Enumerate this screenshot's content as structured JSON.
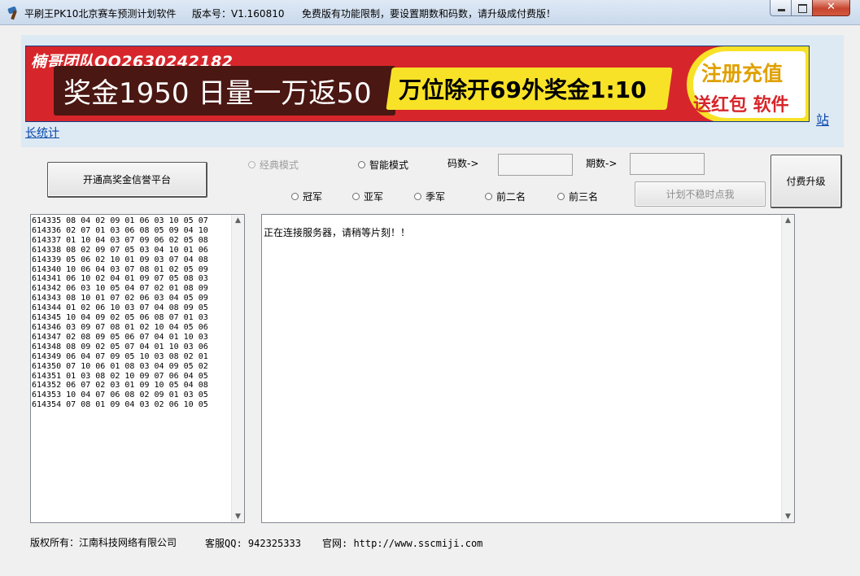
{
  "titlebar": {
    "app_name": "平刷王PK10北京赛车预测计划软件",
    "version": "版本号：V1.160810",
    "notice": "免费版有功能限制，要设置期数和码数，请升级成付费版！",
    "minimize": "—",
    "maximize": "□",
    "close": "✕"
  },
  "banner": {
    "team": "楠哥团队QQ2630242182",
    "main": "奖金1950 日量一万返50",
    "highlight": "万位除开69外奖金1:10",
    "register": "注册充值",
    "bonus": "送红包 软件",
    "link_zhan": "站",
    "link_stats": "长统计"
  },
  "controls": {
    "open_platform_label": "开通高奖金信誉平台",
    "mode_classic": "经典模式",
    "mode_smart": "智能模式",
    "code_count_label": "码数->",
    "period_count_label": "期数->",
    "code_count_value": "",
    "period_count_value": "",
    "upgrade_label": "付费升级",
    "pos_champion": "冠军",
    "pos_second": "亚军",
    "pos_third": "季军",
    "pos_top2": "前二名",
    "pos_top3": "前三名",
    "unstable_label": "计划不稳时点我"
  },
  "history": [
    "614335 08 04 02 09 01 06 03 10 05 07",
    "614336 02 07 01 03 06 08 05 09 04 10",
    "614337 01 10 04 03 07 09 06 02 05 08",
    "614338 08 02 09 07 05 03 04 10 01 06",
    "614339 05 06 02 10 01 09 03 07 04 08",
    "614340 10 06 04 03 07 08 01 02 05 09",
    "614341 06 10 02 04 01 09 07 05 08 03",
    "614342 06 03 10 05 04 07 02 01 08 09",
    "614343 08 10 01 07 02 06 03 04 05 09",
    "614344 01 02 06 10 03 07 04 08 09 05",
    "614345 10 04 09 02 05 06 08 07 01 03",
    "614346 03 09 07 08 01 02 10 04 05 06",
    "614347 02 08 09 05 06 07 04 01 10 03",
    "614348 08 09 02 05 07 04 01 10 03 06",
    "614349 06 04 07 09 05 10 03 08 02 01",
    "614350 07 10 06 01 08 03 04 09 05 02",
    "614351 01 03 08 02 10 09 07 06 04 05",
    "614352 06 07 02 03 01 09 10 05 04 08",
    "614353 10 04 07 06 08 02 09 01 03 05",
    "614354 07 08 01 09 04 03 02 06 10 05"
  ],
  "output": {
    "message": "正在连接服务器，请稍等片刻！！"
  },
  "footer": {
    "copyright": "版权所有：江南科技网络有限公司",
    "service_qq": "客服QQ: 942325333",
    "website_label": "官网: http://www.sscmiji.com"
  },
  "colors": {
    "banner_red": "#d7262b",
    "banner_yellow": "#f7e227",
    "link_blue": "#0645ad"
  }
}
